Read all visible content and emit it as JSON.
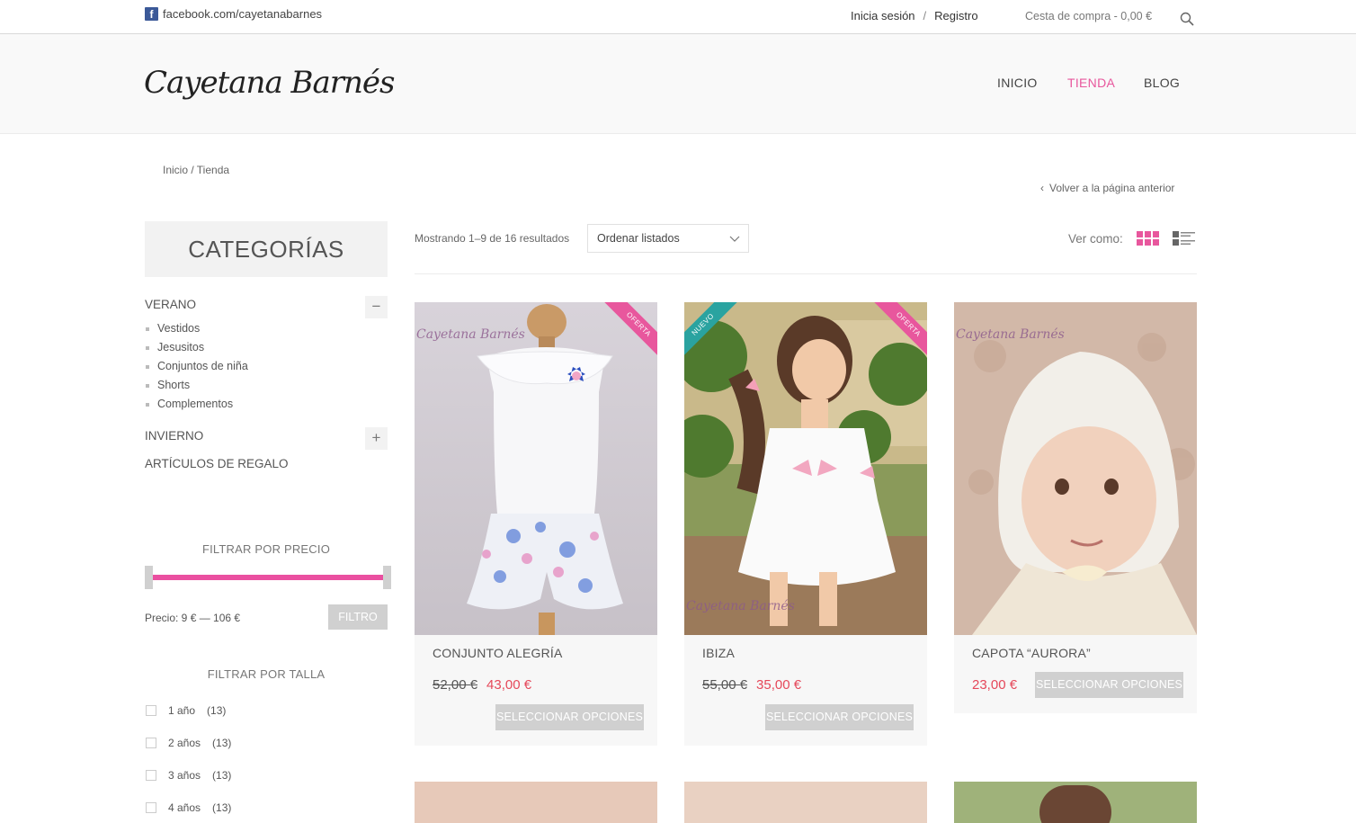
{
  "topbar": {
    "facebook_icon": "facebook-icon",
    "facebook_text": "facebook.com/cayetanabarnes",
    "login": "Inicia sesión",
    "separator": "/",
    "register": "Registro",
    "cart": "Cesta de compra - 0,00 €",
    "search_icon": "search-icon"
  },
  "header": {
    "logo": "Cayetana Barnés",
    "nav": [
      "INICIO",
      "TIENDA",
      "BLOG"
    ],
    "active_color": "#e8579d"
  },
  "breadcrumb": "Inicio / Tienda",
  "back_link": "Volver a la página anterior",
  "sidebar": {
    "categories_title": "CATEGORÍAS",
    "categories": [
      {
        "label": "VERANO",
        "toggle": "−",
        "children": [
          "Vestidos",
          "Jesusitos",
          "Conjuntos de niña",
          "Shorts",
          "Complementos"
        ]
      },
      {
        "label": "INVIERNO",
        "toggle": "+"
      },
      {
        "label": "ARTÍCULOS DE REGALO"
      }
    ],
    "price_filter": {
      "title": "FILTRAR POR PRECIO",
      "label": "Precio: 9 € — 106 €",
      "min": 9,
      "max": 106,
      "button": "FILTRO"
    },
    "size_filter": {
      "title": "FILTRAR POR TALLA",
      "options": [
        {
          "label": "1 año",
          "count": "(13)"
        },
        {
          "label": "2 años",
          "count": "(13)"
        },
        {
          "label": "3 años",
          "count": "(13)"
        },
        {
          "label": "4 años",
          "count": "(13)"
        }
      ]
    }
  },
  "toolbar": {
    "showing": "Mostrando 1–9 de 16 resultados",
    "sort": "Ordenar listados",
    "view_label": "Ver como:",
    "grid_icon": "grid-view-icon",
    "list_icon": "list-view-icon",
    "grid_color": "#e8579d"
  },
  "products": [
    {
      "name": "CONJUNTO ALEGRÍA",
      "old_price": "52,00 €",
      "price": "43,00 €",
      "button": "SELECCIONAR OPCIONES",
      "badge_right": "OFERTA",
      "watermark": "Cayetana Barnés"
    },
    {
      "name": "IBIZA",
      "old_price": "55,00 €",
      "price": "35,00 €",
      "button": "SELECCIONAR OPCIONES",
      "badge_left": "NUEVO",
      "badge_right": "OFERTA",
      "watermark": "Cayetana Barnés"
    },
    {
      "name": "CAPOTA “AURORA”",
      "price": "23,00 €",
      "button": "SELECCIONAR OPCIONES",
      "watermark": "Cayetana Barnés"
    }
  ]
}
